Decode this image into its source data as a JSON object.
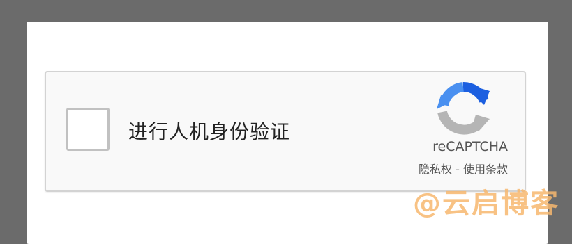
{
  "recaptcha": {
    "checkbox_label": "进行人机身份验证",
    "brand": "reCAPTCHA",
    "privacy_link": "隐私权",
    "separator": " - ",
    "terms_link": "使用条款"
  },
  "watermark": "@云启博客",
  "colors": {
    "logo_blue": "#1c5fe0",
    "logo_light_blue": "#4a90f0",
    "logo_gray": "#b5b5b5",
    "watermark": "#f7b76e"
  },
  "icons": {
    "logo": "recaptcha-logo-icon"
  }
}
